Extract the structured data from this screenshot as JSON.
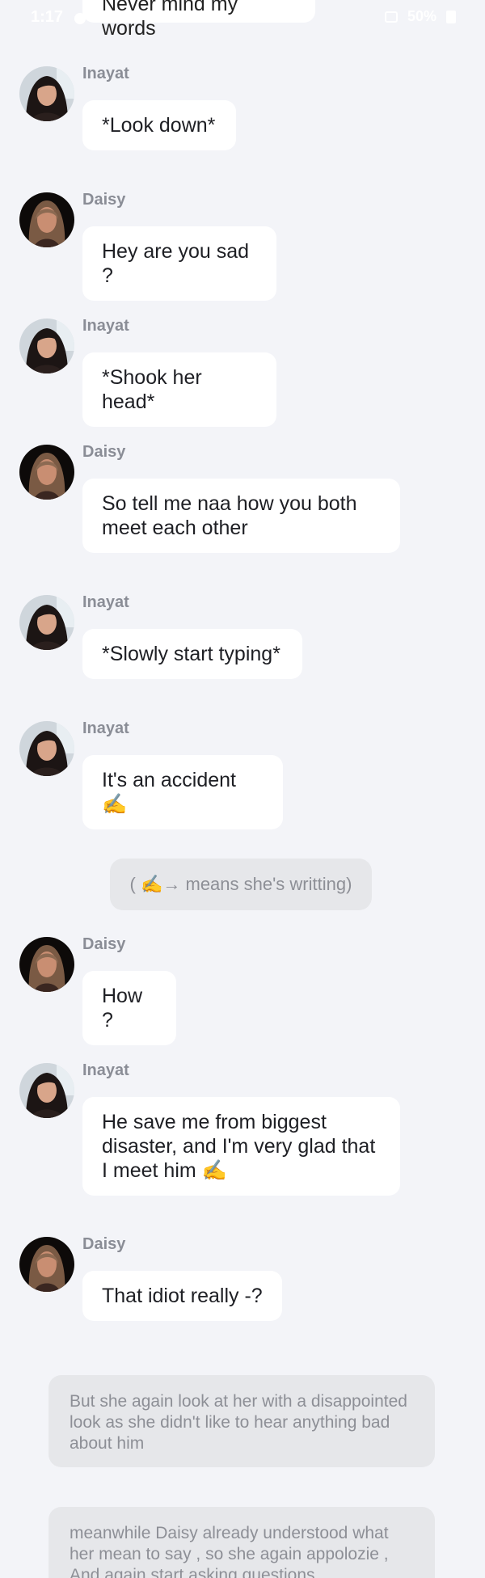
{
  "status_bar": {
    "time": "1:17",
    "battery": "50%"
  },
  "top_partial_message": {
    "text": "Never mind my words"
  },
  "messages": [
    {
      "sender": "Inayat",
      "text": "*Look down*"
    },
    {
      "sender": "Daisy",
      "text": "Hey are you sad ?"
    },
    {
      "sender": "Inayat",
      "text": "*Shook her head*"
    },
    {
      "sender": "Daisy",
      "text": "So tell me naa how you both meet each other"
    },
    {
      "sender": "Inayat",
      "text": "*Slowly start typing*"
    },
    {
      "sender": "Inayat",
      "text": "It's an accident ✍️"
    },
    {
      "sender": "Daisy",
      "text": "How ?"
    },
    {
      "sender": "Inayat",
      "text": "He save me from biggest disaster, and I'm very glad that I meet him  ✍️"
    },
    {
      "sender": "Daisy",
      "text": "That idiot really -?"
    }
  ],
  "narrations": [
    {
      "text": "( ✍️→ means she's writting)"
    },
    {
      "text": "But she again look at her with a disappointed look as she didn't like to hear anything bad about him"
    },
    {
      "text": "meanwhile Daisy already understood what her mean to say , so she again appolozie , And again start asking questions"
    }
  ],
  "colors": {
    "background": "#f3f4f8",
    "bubble": "#ffffff",
    "narration_background": "#e6e7ea",
    "sender_text": "#8a8d96",
    "narration_text": "#8d8f96"
  }
}
